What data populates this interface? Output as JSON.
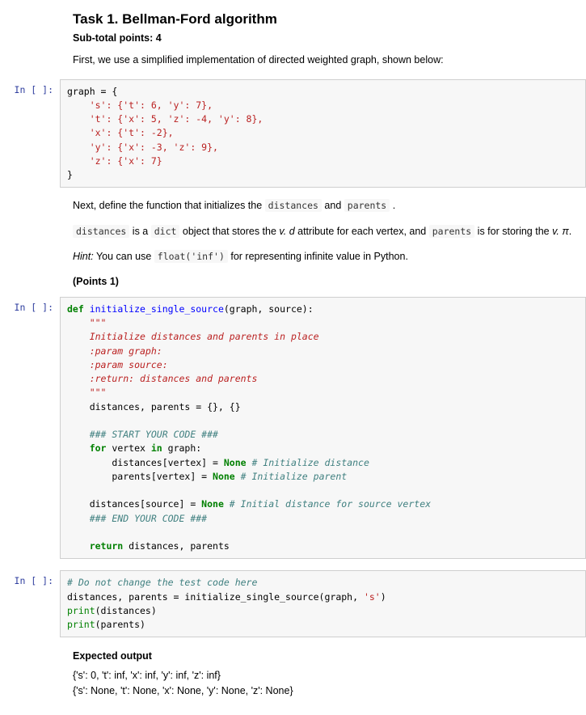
{
  "task": {
    "title": "Task 1. Bellman-Ford algorithm",
    "subtotal": "Sub-total points: 4",
    "intro": "First, we use a simplified implementation of directed weighted graph, shown below:"
  },
  "cell1": {
    "prompt": "In [ ]:",
    "l1": "graph = {",
    "l2": "    's': {'t': 6, 'y': 7},",
    "l3": "    't': {'x': 5, 'z': -4, 'y': 8},",
    "l4": "    'x': {'t': -2},",
    "l5": "    'y': {'x': -3, 'z': 9},",
    "l6": "    'z': {'x': 7}",
    "l7": "}"
  },
  "mid": {
    "p_next_pre": "Next, define the function that initializes the ",
    "code_dist": "distances",
    "p_next_mid": " and ",
    "code_par": "parents",
    "p_next_end": " .",
    "p_dist_pre": " is a ",
    "code_dict": "dict",
    "p_dist_mid": " object that stores the ",
    "vd_v": "v.",
    "vd_d": " d",
    "p_dist_mid2": " attribute for each vertex, and ",
    "p_dist_mid3": " is for storing the ",
    "vpi_v": "v.",
    "vpi_pi": " π",
    "p_dist_end": ".",
    "hint_label": "Hint:",
    "hint_pre": " You can use ",
    "code_float": "float('inf')",
    "hint_post": " for representing infinite value in Python.",
    "points": "(Points 1)"
  },
  "cell2": {
    "prompt": "In [ ]:",
    "l1_def": "def ",
    "l1_name": "initialize_single_source",
    "l1_rest": "(graph, source):",
    "l2": "    \"\"\"",
    "l3": "    Initialize distances and parents in place",
    "l4": "    :param graph:",
    "l5": "    :param source:",
    "l6": "    :return: distances and parents",
    "l7": "    \"\"\"",
    "l8": "    distances, parents = {}, {}",
    "l9": "",
    "l10": "    ### START YOUR CODE ###",
    "l11_a": "    ",
    "l11_for": "for",
    "l11_b": " vertex ",
    "l11_in": "in",
    "l11_c": " graph:",
    "l12_a": "        distances[vertex] = ",
    "l12_none": "None",
    "l12_cmt": " # Initialize distance",
    "l13_a": "        parents[vertex] = ",
    "l13_none": "None",
    "l13_cmt": " # Initialize parent",
    "l14": "",
    "l15_a": "    distances[source] = ",
    "l15_none": "None",
    "l15_cmt": " # Initial distance for source vertex",
    "l16": "    ### END YOUR CODE ###",
    "l17": "",
    "l18_ret": "    return",
    "l18_rest": " distances, parents"
  },
  "cell3": {
    "prompt": "In [ ]:",
    "l1": "# Do not change the test code here",
    "l2_a": "distances, parents = initialize_single_source(graph, ",
    "l2_s": "'s'",
    "l2_b": ")",
    "l3_a": "print",
    "l3_b": "(distances)",
    "l4_a": "print",
    "l4_b": "(parents)"
  },
  "expected": {
    "title": "Expected output",
    "l1": "{'s': 0, 't': inf, 'x': inf, 'y': inf, 'z': inf}",
    "l2": "{'s': None, 't': None, 'x': None, 'y': None, 'z': None}"
  }
}
